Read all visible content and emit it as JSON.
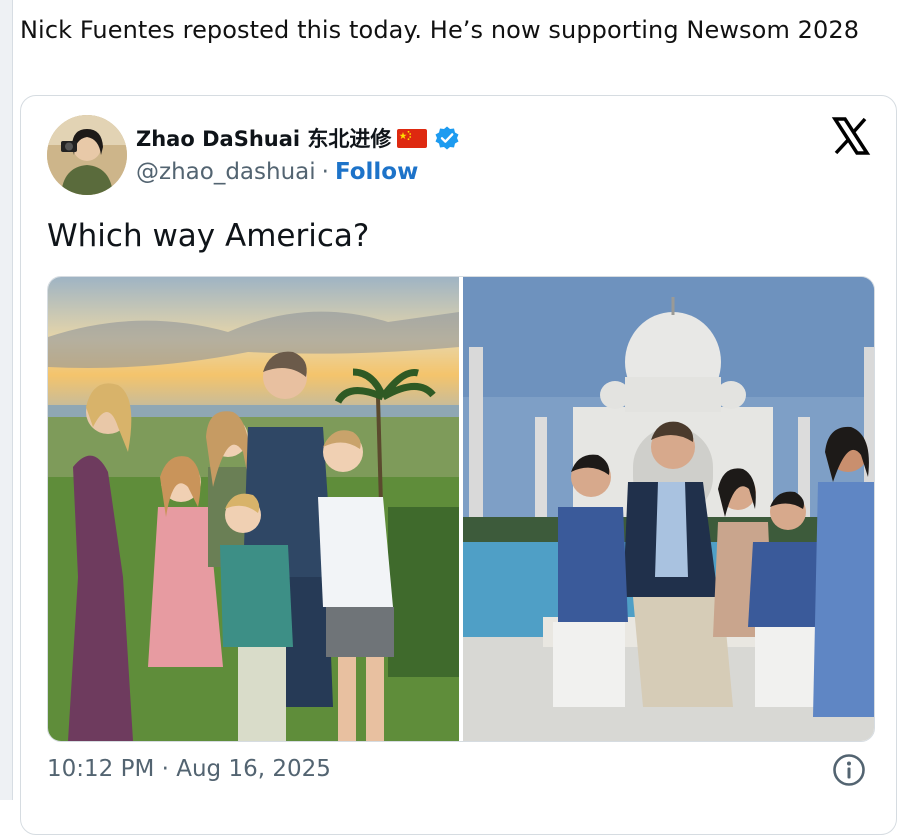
{
  "post": {
    "caption": "Nick Fuentes reposted this today. He’s now supporting Newsom 2028"
  },
  "embed": {
    "author_name": "Zhao DaShuai 东北进修",
    "handle": "@zhao_dashuai",
    "separator": "·",
    "follow_label": "Follow",
    "tweet_text": "Which way America?",
    "timestamp": "10:12 PM · Aug 16, 2025",
    "icons": {
      "flag": "china-flag-icon",
      "verified": "verified-badge-icon",
      "platform": "x-logo-icon",
      "info": "info-icon"
    },
    "colors": {
      "follow": "#1d73c9",
      "verified": "#1d9bf0",
      "muted_text": "#536471",
      "border": "#d6dce1"
    }
  }
}
